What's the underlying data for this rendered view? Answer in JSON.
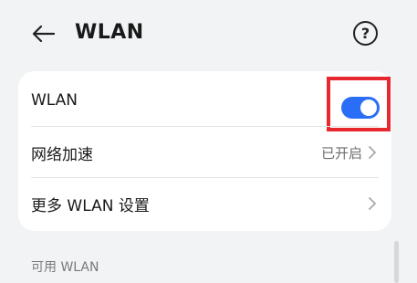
{
  "header": {
    "title": "WLAN",
    "back_icon": "arrow-left-icon",
    "help_icon": "question-mark-icon",
    "help_glyph": "?"
  },
  "settings": {
    "wlan_toggle": {
      "label": "WLAN",
      "enabled": true,
      "accent": "#2a6ef7"
    },
    "network_acceleration": {
      "label": "网络加速",
      "value": "已开启"
    },
    "more_wlan_settings": {
      "label": "更多 WLAN 设置"
    }
  },
  "available": {
    "section_label": "可用 WLAN"
  },
  "colors": {
    "background": "#f1f3f5",
    "card": "#ffffff",
    "highlight_box": "#e8282f"
  }
}
